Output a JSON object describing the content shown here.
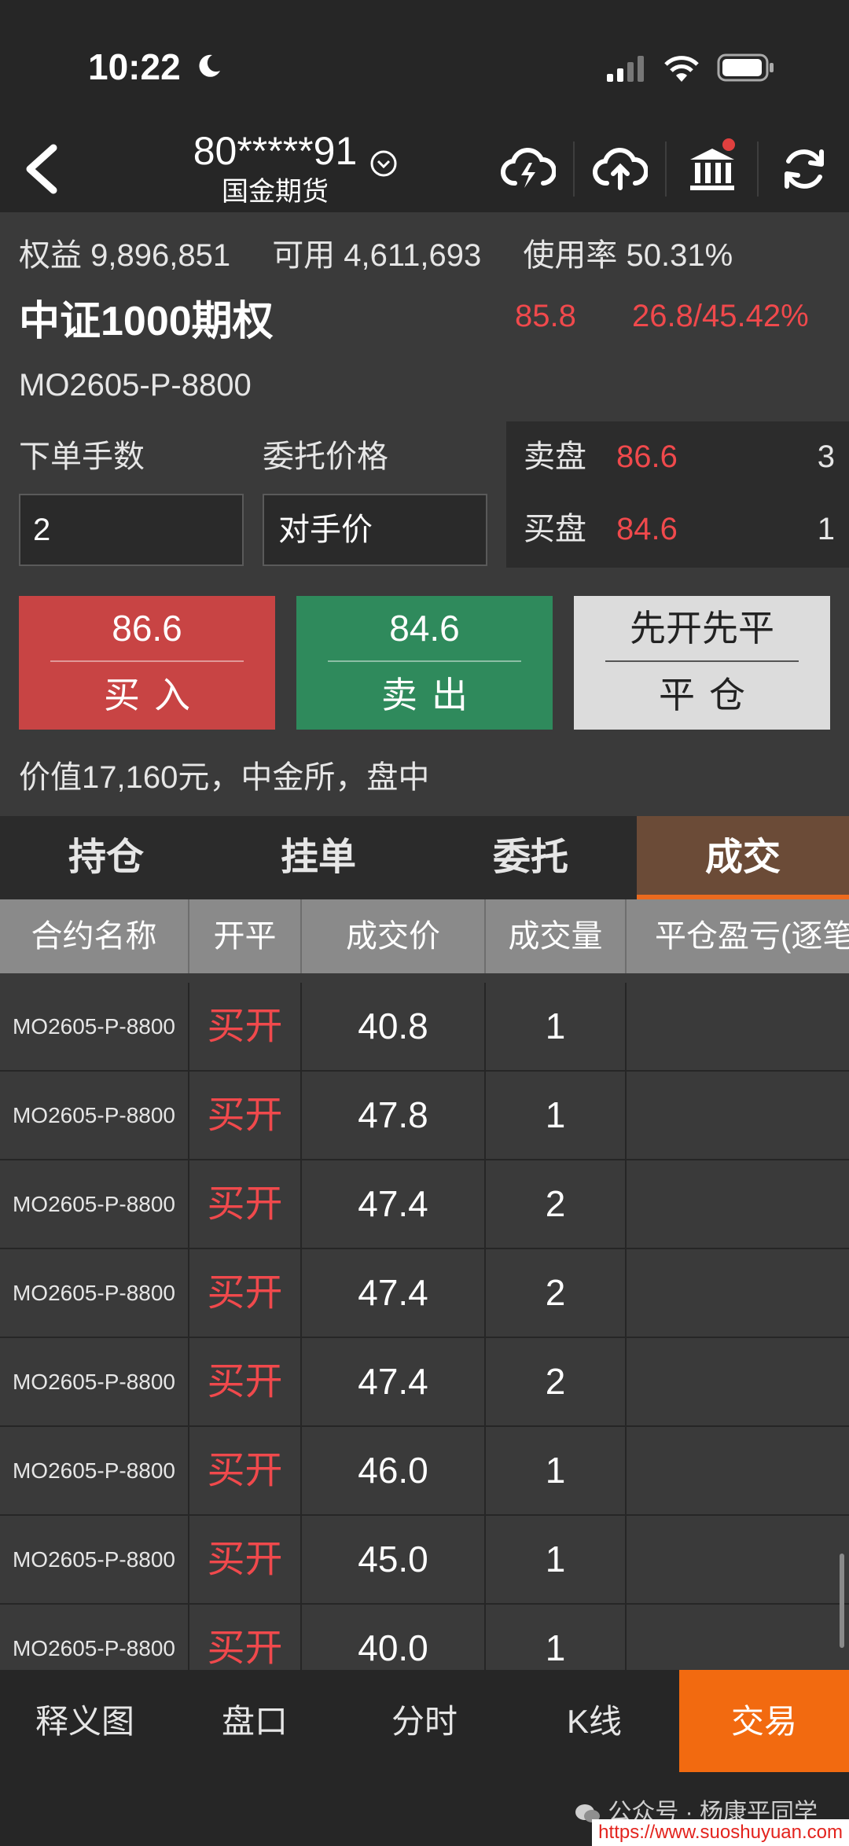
{
  "status_bar": {
    "time": "10:22"
  },
  "header": {
    "account_id": "80*****91",
    "broker": "国金期货",
    "icons": [
      "back-icon",
      "chevron-down-icon",
      "cloud-lightning-icon",
      "cloud-upload-icon",
      "bank-icon",
      "refresh-icon"
    ]
  },
  "account": {
    "equity": "权益 9,896,851",
    "available": "可用 4,611,693",
    "usage": "使用率 50.31%"
  },
  "contract": {
    "name": "中证1000期权",
    "last_price": "85.8",
    "change": "26.8/45.42%",
    "code": "MO2605-P-8800"
  },
  "order_form": {
    "qty_label": "下单手数",
    "price_label": "委托价格",
    "qty_value": "2",
    "price_value": "对手价"
  },
  "order_book": {
    "ask": {
      "label": "卖盘",
      "price": "86.6",
      "volume": "3"
    },
    "bid": {
      "label": "买盘",
      "price": "84.6",
      "volume": "1"
    }
  },
  "actions": {
    "buy": {
      "price": "86.6",
      "label": "买入"
    },
    "sell": {
      "price": "84.6",
      "label": "卖出"
    },
    "close": {
      "top": "先开先平",
      "label": "平仓"
    }
  },
  "value_info": "价值17,160元，中金所，盘中",
  "tabs": [
    {
      "label": "持仓",
      "active": false
    },
    {
      "label": "挂单",
      "active": false
    },
    {
      "label": "委托",
      "active": false
    },
    {
      "label": "成交",
      "active": true
    }
  ],
  "table": {
    "headers": [
      "合约名称",
      "开平",
      "成交价",
      "成交量",
      "平仓盈亏(逐笔)"
    ],
    "rows": [
      {
        "name": "MO2605-P-8800",
        "side": "买开",
        "price": "40.8",
        "qty": "1",
        "pnl": ""
      },
      {
        "name": "MO2605-P-8800",
        "side": "买开",
        "price": "47.8",
        "qty": "1",
        "pnl": ""
      },
      {
        "name": "MO2605-P-8800",
        "side": "买开",
        "price": "47.4",
        "qty": "2",
        "pnl": ""
      },
      {
        "name": "MO2605-P-8800",
        "side": "买开",
        "price": "47.4",
        "qty": "2",
        "pnl": ""
      },
      {
        "name": "MO2605-P-8800",
        "side": "买开",
        "price": "47.4",
        "qty": "2",
        "pnl": ""
      },
      {
        "name": "MO2605-P-8800",
        "side": "买开",
        "price": "46.0",
        "qty": "1",
        "pnl": ""
      },
      {
        "name": "MO2605-P-8800",
        "side": "买开",
        "price": "45.0",
        "qty": "1",
        "pnl": ""
      },
      {
        "name": "MO2605-P-8800",
        "side": "买开",
        "price": "40.0",
        "qty": "1",
        "pnl": ""
      }
    ]
  },
  "bottom_nav": [
    {
      "label": "释义图",
      "active": false
    },
    {
      "label": "盘口",
      "active": false
    },
    {
      "label": "分时",
      "active": false
    },
    {
      "label": "K线",
      "active": false
    },
    {
      "label": "交易",
      "active": true
    }
  ],
  "watermark": "公众号 · 杨康平同学",
  "footer_url": "https://www.suoshuyuan.com",
  "colors": {
    "up": "#f0494c",
    "buy": "#c84444",
    "sell": "#2f8a5c",
    "accent": "#f26a10"
  }
}
